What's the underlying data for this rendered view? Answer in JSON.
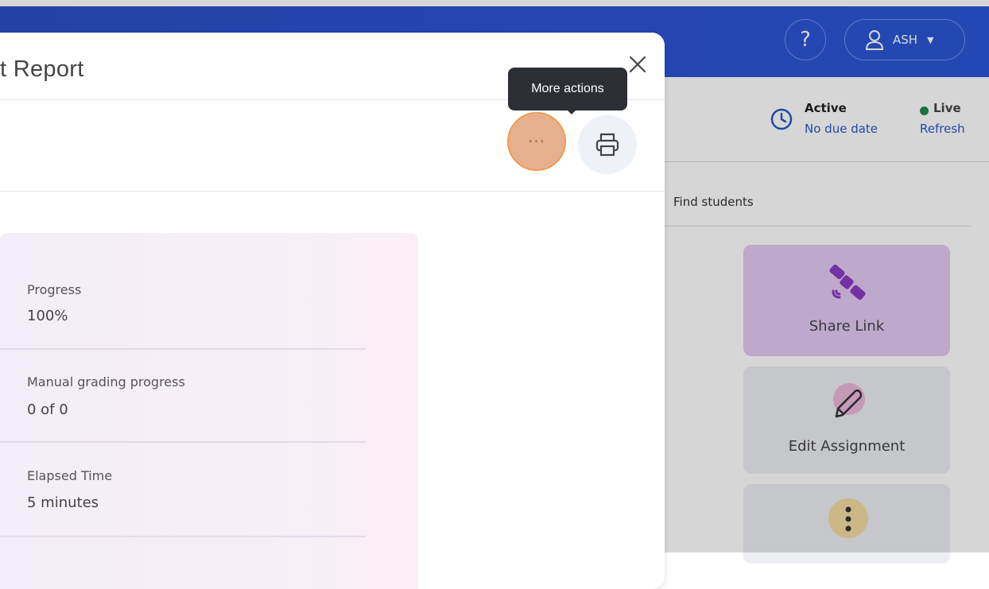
{
  "header": {
    "help_label": "?",
    "user_name": "ASH"
  },
  "status": {
    "state": "Active",
    "due": "No due date",
    "live": "Live",
    "refresh": "Refresh"
  },
  "search": {
    "placeholder": "Find students"
  },
  "actions": [
    {
      "label": "Share Link",
      "icon": "satellite-icon"
    },
    {
      "label": "Edit Assignment",
      "icon": "pencil-icon"
    },
    {
      "label": "",
      "icon": "more-vertical-icon"
    }
  ],
  "modal": {
    "title": "t Report",
    "tooltip": "More actions",
    "more_label": "···"
  },
  "stats": [
    {
      "label": "Progress",
      "value": "100%"
    },
    {
      "label": "Manual grading progress",
      "value": "0 of 0"
    },
    {
      "label": "Elapsed Time",
      "value": "5 minutes"
    }
  ],
  "colors": {
    "brand": "#2d54d2",
    "link": "#2a57c7",
    "live": "#1f8a4c",
    "highlight": "#f39a50"
  }
}
